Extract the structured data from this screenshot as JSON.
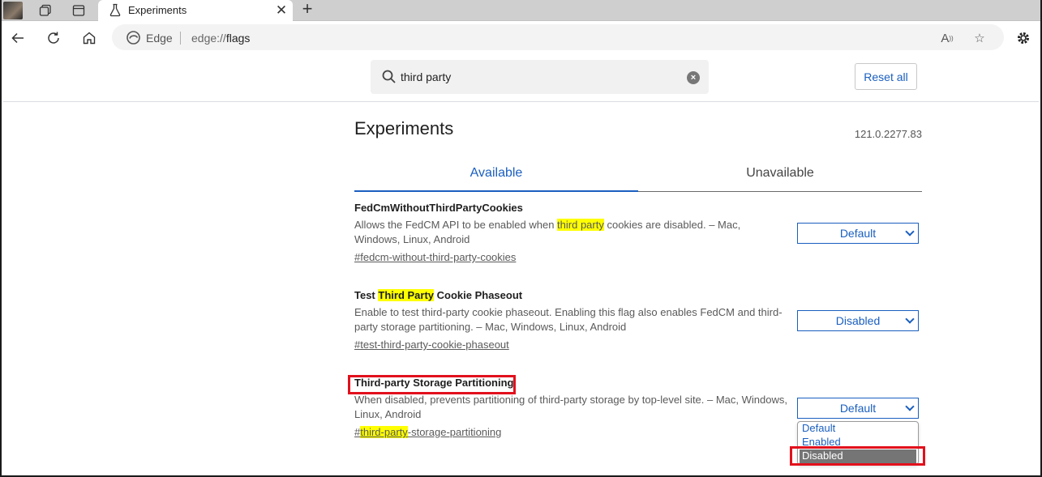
{
  "browser": {
    "tab_title": "Experiments",
    "omnibox_site": "Edge",
    "omnibox_url_prefix": "edge://",
    "omnibox_url_path": "flags"
  },
  "flags_header": {
    "search_value": "third party",
    "reset_label": "Reset all"
  },
  "page": {
    "heading": "Experiments",
    "version": "121.0.2277.83",
    "tabs": [
      "Available",
      "Unavailable"
    ]
  },
  "experiments": [
    {
      "name": "FedCmWithoutThirdPartyCookies",
      "desc_before": "Allows the FedCM API to be enabled when ",
      "desc_highlight": "third party",
      "desc_after": " cookies are disabled. – Mac, Windows, Linux, Android",
      "link": "#fedcm-without-third-party-cookies",
      "value": "Default"
    },
    {
      "name_before": "Test ",
      "name_highlight": "Third Party",
      "name_after": " Cookie Phaseout",
      "desc": "Enable to test third-party cookie phaseout. Enabling this flag also enables FedCM and third-party storage partitioning. – Mac, Windows, Linux, Android",
      "link": "#test-third-party-cookie-phaseout",
      "value": "Disabled"
    },
    {
      "name": "Third-party Storage Partitioning",
      "desc": "When disabled, prevents partitioning of third-party storage by top-level site. – Mac, Windows, Linux, Android",
      "link_prefix": "#",
      "link_highlight": "third-party",
      "link_after": "-storage-partitioning",
      "value": "Default"
    }
  ],
  "dropdown_options": [
    "Default",
    "Enabled",
    "Disabled"
  ],
  "colors": {
    "accent": "#1a5fc0",
    "highlight": "#ffff00",
    "annotation": "#e2101c"
  }
}
